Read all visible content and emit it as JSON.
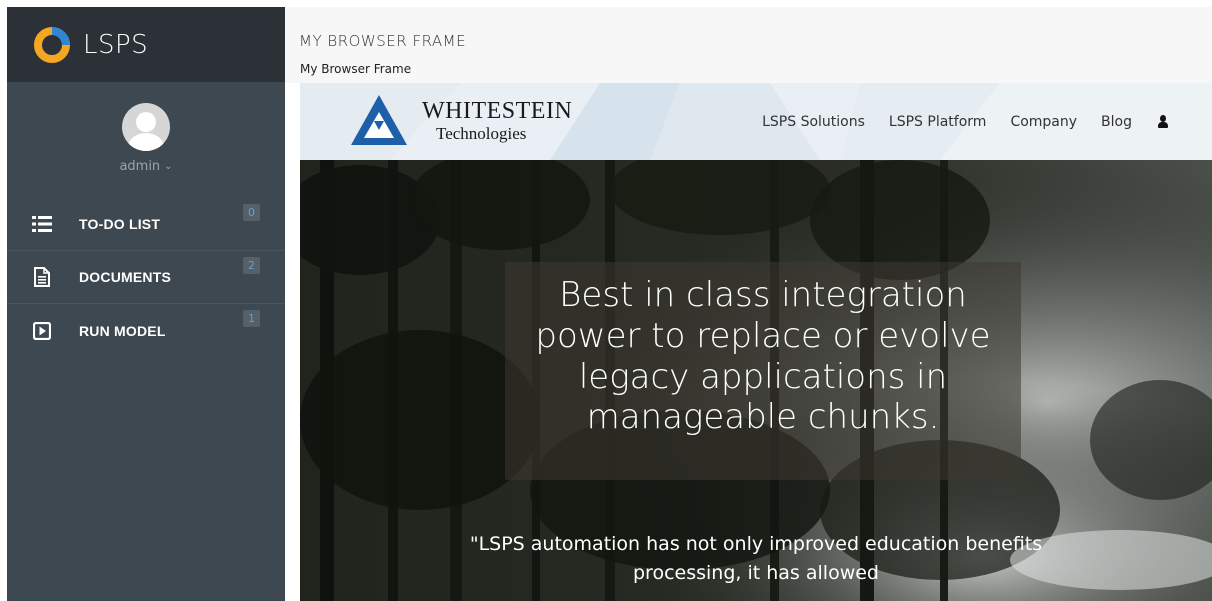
{
  "app": {
    "name": "LSPS"
  },
  "user": {
    "name": "admin",
    "caret": "⌄"
  },
  "sidebar": {
    "items": [
      {
        "label": "TO-DO LIST",
        "count": "0",
        "icon": "list-icon"
      },
      {
        "label": "DOCUMENTS",
        "count": "2",
        "icon": "document-icon"
      },
      {
        "label": "RUN MODEL",
        "count": "1",
        "icon": "play-icon"
      }
    ]
  },
  "frame": {
    "title": "MY BROWSER FRAME",
    "subtitle": "My Browser Frame"
  },
  "website": {
    "logo_line1": "WHITESTEIN",
    "logo_line2": "Technologies",
    "nav_links": [
      "LSPS Solutions",
      "LSPS Platform",
      "Company",
      "Blog"
    ],
    "user_icon": "user-icon",
    "hero_headline": "Best in class integration power to replace or evolve legacy applications in manageable chunks.",
    "hero_quote": "\"LSPS automation has not only improved education benefits processing, it has allowed"
  },
  "colors": {
    "sidebar_bg": "#3d4850",
    "brand_bg": "#2b3136",
    "badge_text": "#5aa2db",
    "logo_blue": "#1d5fa8",
    "logo_orange": "#f5a623"
  }
}
